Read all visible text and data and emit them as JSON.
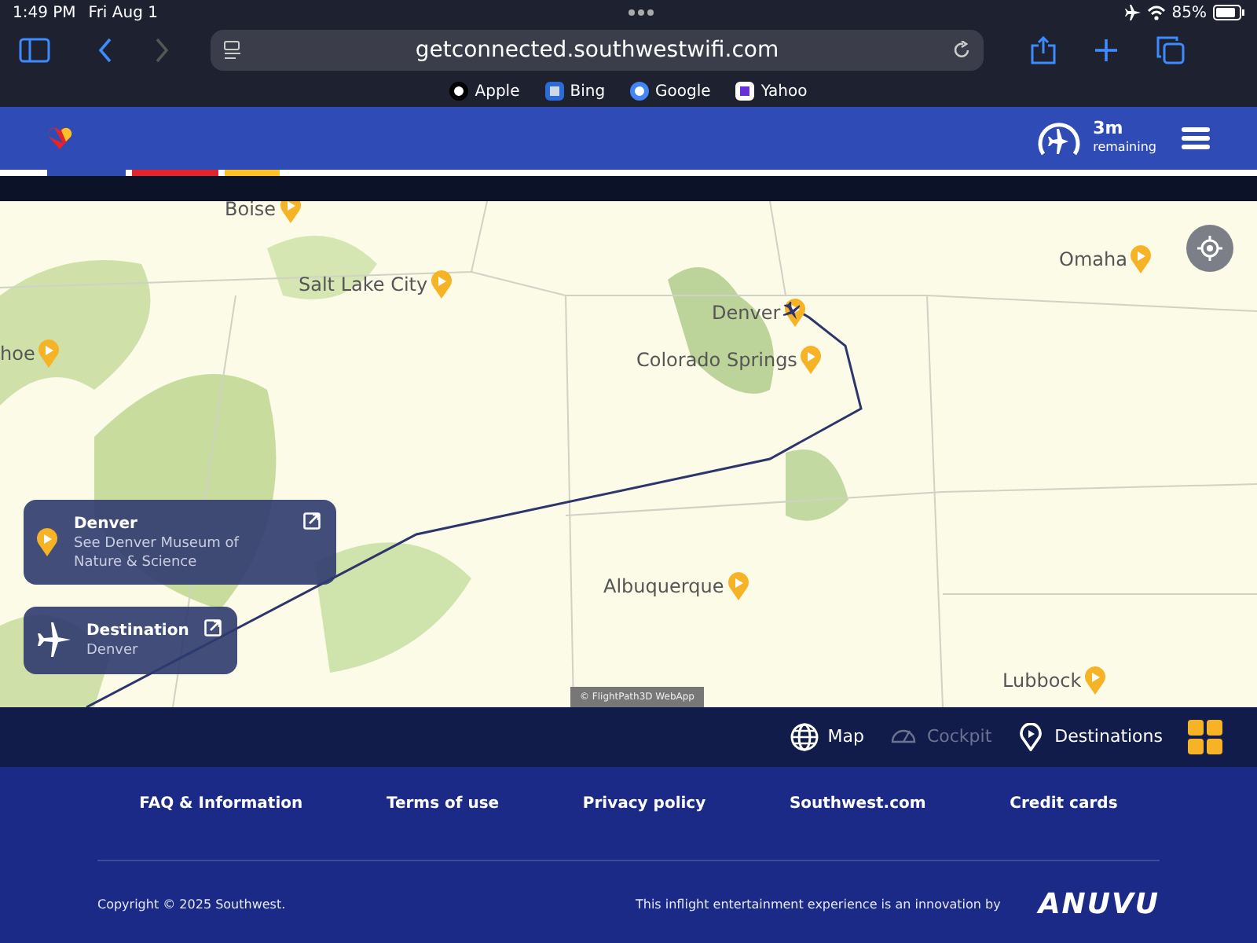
{
  "status_bar": {
    "time": "1:49 PM",
    "date": "Fri Aug 1",
    "battery": "85%"
  },
  "browser": {
    "url": "getconnected.southwestwifi.com",
    "bookmarks": [
      "Apple",
      "Bing",
      "Google",
      "Yahoo"
    ]
  },
  "header": {
    "remaining_time": "3m",
    "remaining_label": "remaining"
  },
  "map": {
    "cities": [
      "Boise",
      "Salt Lake City",
      "hoe",
      "Denver",
      "Colorado Springs",
      "Omaha",
      "Albuquerque",
      "Lubbock"
    ],
    "popups": [
      {
        "kind": "poi",
        "title": "Denver",
        "subtitle": "See Denver Museum of Nature & Science"
      },
      {
        "kind": "destination",
        "title": "Destination",
        "subtitle": "Denver"
      }
    ],
    "attribution": "© FlightPath3D WebApp"
  },
  "nav": [
    {
      "kind": "map",
      "label": "Map",
      "disabled": false
    },
    {
      "kind": "cockpit",
      "label": "Cockpit",
      "disabled": true
    },
    {
      "kind": "destinations",
      "label": "Destinations",
      "disabled": false
    }
  ],
  "footer": {
    "links": [
      "FAQ & Information",
      "Terms of use",
      "Privacy policy",
      "Southwest.com",
      "Credit cards"
    ],
    "copyright": "Copyright © 2025 Southwest.",
    "credit": "This inflight entertainment experience is an innovation by",
    "logo": "ANUVU"
  }
}
